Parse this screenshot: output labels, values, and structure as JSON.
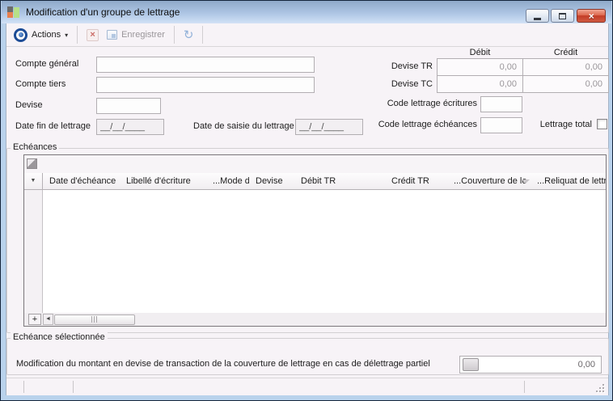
{
  "window": {
    "title": "Modification d'un groupe de lettrage",
    "close_glyph": "×"
  },
  "toolbar": {
    "actions_label": "Actions",
    "actions_dropdown_glyph": "▾",
    "delete_glyph": "×",
    "save_label": "Enregistrer",
    "refresh_glyph": "↻"
  },
  "form": {
    "compte_general_label": "Compte général",
    "compte_general_value": "",
    "compte_tiers_label": "Compte tiers",
    "compte_tiers_value": "",
    "devise_label": "Devise",
    "devise_value": "",
    "date_fin_label": "Date fin de lettrage",
    "date_fin_value": "__/__/____",
    "date_saisie_label": "Date de saisie du lettrage",
    "date_saisie_value": "__/__/____",
    "code_ecritures_label": "Code lettrage écritures",
    "code_ecritures_value": "",
    "code_echeances_label": "Code lettrage échéances",
    "code_echeances_value": "",
    "lettrage_total_label": "Lettrage total",
    "lettrage_total_checked": false
  },
  "totals": {
    "debit_header": "Débit",
    "credit_header": "Crédit",
    "devise_tr_label": "Devise TR",
    "devise_tc_label": "Devise TC",
    "tr_debit": "0,00",
    "tr_credit": "0,00",
    "tc_debit": "0,00",
    "tc_credit": "0,00"
  },
  "echeances": {
    "label": "Echéances",
    "selector_glyph": "▼",
    "columns": [
      "Date d'échéance",
      "Libellé d'écriture",
      "...Mode d",
      "Devise",
      "Débit TR",
      "Crédit TR",
      "...Couverture de le",
      "...Reliquat de lettra"
    ],
    "rows": [],
    "add_row_glyph": "+",
    "scroll_left_glyph": "◄"
  },
  "selection": {
    "label": "Echéance sélectionnée",
    "description": "Modification du montant en devise de transaction de la couverture de lettrage en cas de délettrage partiel",
    "amount_value": "0,00"
  },
  "colors": {
    "titlebar_top": "#8fa9c9",
    "titlebar_bottom": "#d3e2f5",
    "frame_blue": "#b9d2ec",
    "client_bg": "#f7f3f7",
    "close_button_red": "#c23c26",
    "accent_blue": "#1d4c96",
    "disabled_text": "#9a969a",
    "app_icon_orange": "#e8804f",
    "app_icon_green": "#b6e087"
  }
}
